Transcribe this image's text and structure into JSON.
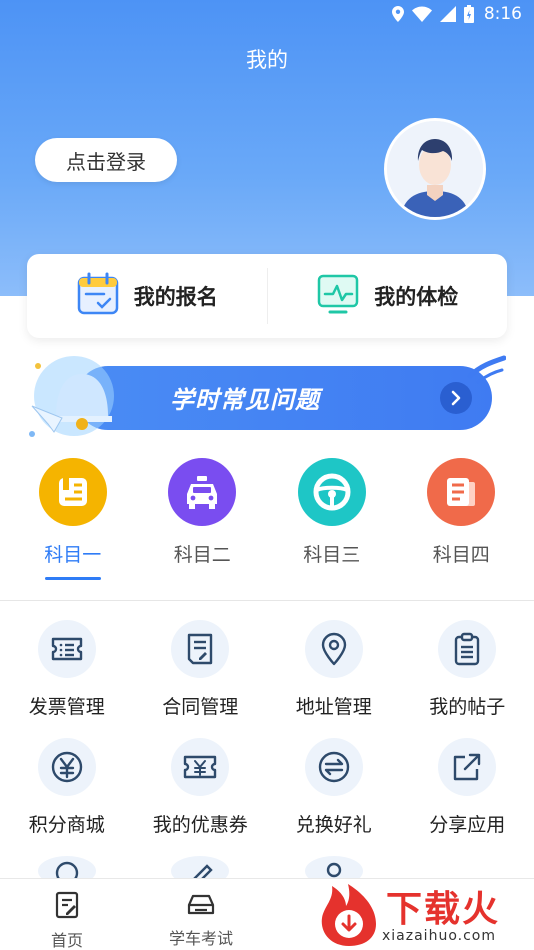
{
  "status_bar": {
    "time": "8:16"
  },
  "header": {
    "title": "我的"
  },
  "profile": {
    "login_label": "点击登录"
  },
  "quick_actions": [
    {
      "label": "我的报名",
      "icon": "calendar-check-icon"
    },
    {
      "label": "我的体检",
      "icon": "monitor-pulse-icon"
    }
  ],
  "banner": {
    "title": "学时常见问题"
  },
  "subjects": [
    {
      "label": "科目一",
      "icon": "book-icon",
      "color": "#f5b400",
      "active": true
    },
    {
      "label": "科目二",
      "icon": "car-icon",
      "color": "#7a4df0",
      "active": false
    },
    {
      "label": "科目三",
      "icon": "steering-wheel-icon",
      "color": "#1ec6c6",
      "active": false
    },
    {
      "label": "科目四",
      "icon": "document-icon",
      "color": "#f06a4a",
      "active": false
    }
  ],
  "services": [
    {
      "label": "发票管理",
      "icon": "invoice-icon"
    },
    {
      "label": "合同管理",
      "icon": "contract-icon"
    },
    {
      "label": "地址管理",
      "icon": "location-pin-icon"
    },
    {
      "label": "我的帖子",
      "icon": "clipboard-icon"
    },
    {
      "label": "积分商城",
      "icon": "yen-coin-icon"
    },
    {
      "label": "我的优惠券",
      "icon": "coupon-icon"
    },
    {
      "label": "兑换好礼",
      "icon": "exchange-icon"
    },
    {
      "label": "分享应用",
      "icon": "share-icon"
    }
  ],
  "tabbar": [
    {
      "label": "首页",
      "icon": "home-doc-icon"
    },
    {
      "label": "学车考试",
      "icon": "car-outline-icon"
    }
  ],
  "watermark": {
    "text": "下载火",
    "url": "xiazaihuo.com"
  },
  "colors": {
    "primary": "#2f7cf6",
    "hero": "#4d93f5",
    "icon_bg": "#edf3fb",
    "icon_stroke": "#2e4a6b"
  }
}
